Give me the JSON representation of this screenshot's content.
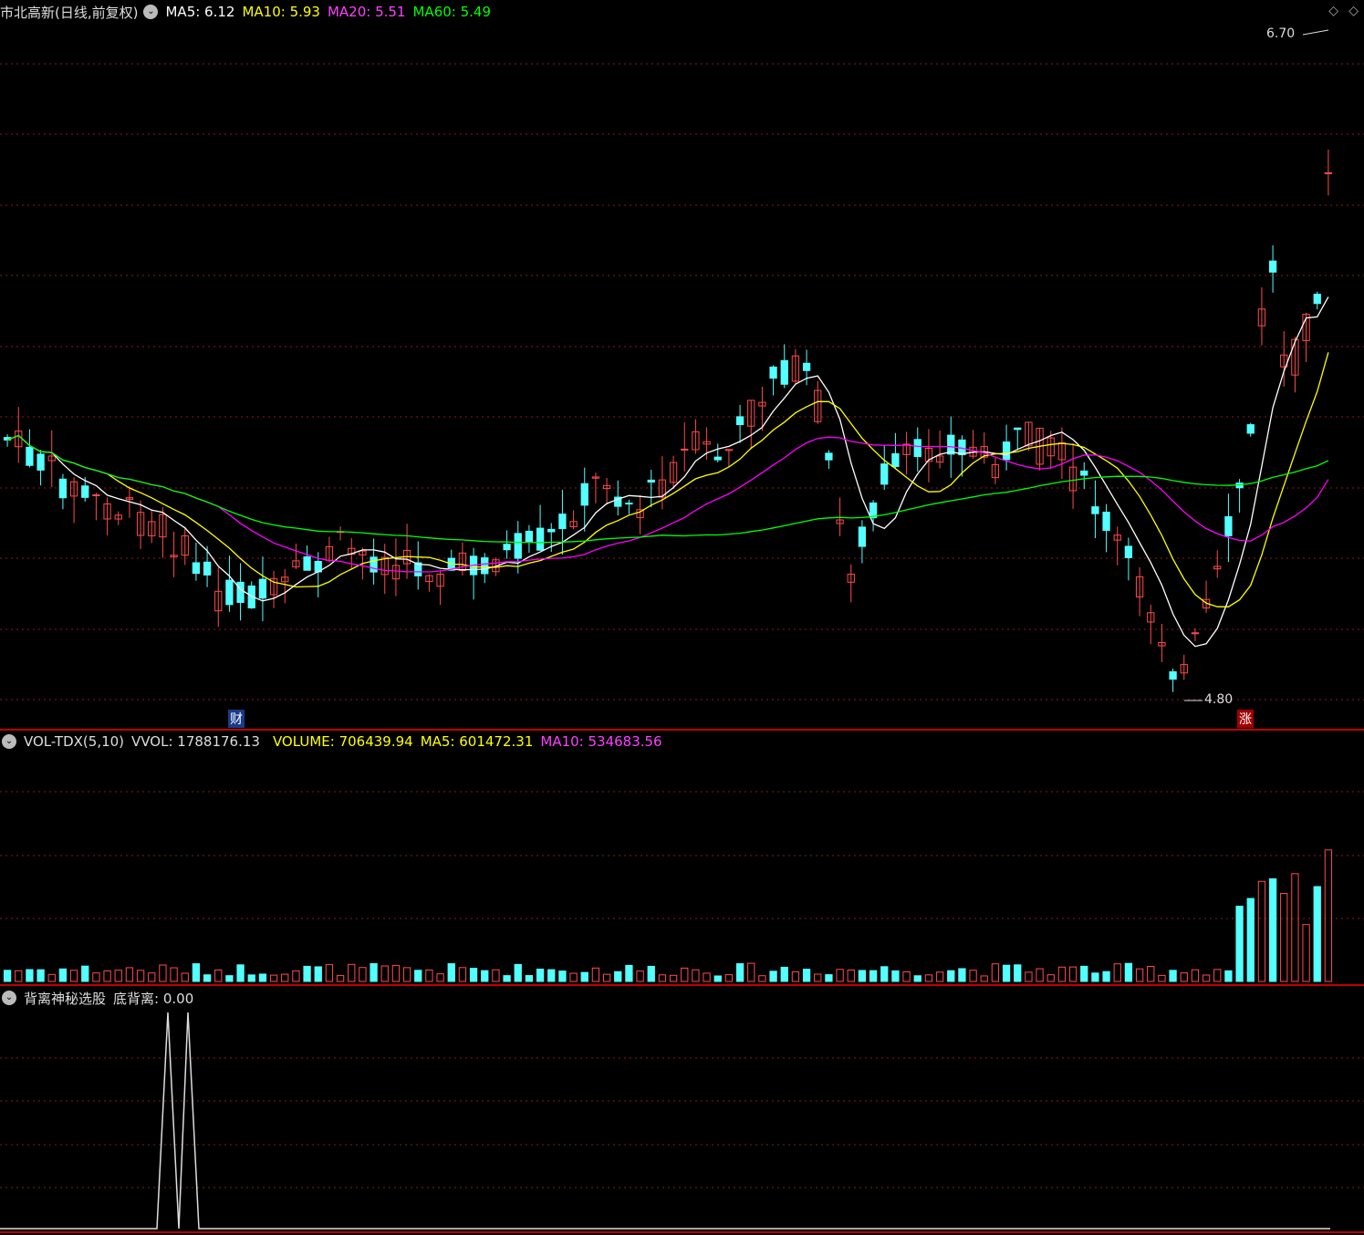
{
  "main": {
    "title": "市北高新(日线,前复权)",
    "ma5": "MA5: 6.12",
    "ma10": "MA10: 5.93",
    "ma20": "MA20: 5.51",
    "ma60": "MA60: 5.49",
    "high_label": "6.70",
    "low_label": "4.80",
    "cai_tag": "财",
    "zhang_tag": "涨",
    "collapse_icon": "chevron-down-icon",
    "diamond_icon": "diamond-icon"
  },
  "vol": {
    "title": "VOL-TDX(5,10)",
    "vvol": "VVOL: 1788176.13",
    "volume": "VOLUME: 706439.94",
    "ma5": "MA5: 601472.31",
    "ma10": "MA10: 534683.56"
  },
  "indicator": {
    "title": "背离神秘选股",
    "value": "底背离: 0.00"
  },
  "colors": {
    "up": "#ff4b4b",
    "down": "#54ffff",
    "ma5": "#ffffff",
    "ma10": "#ffff00",
    "ma20": "#ff00ff",
    "ma60": "#00ff00",
    "grid": "#8b1a1a",
    "divider": "#c00000"
  },
  "chart_data": {
    "type": "candlestick",
    "price_range": [
      4.8,
      6.7
    ],
    "series": [
      "MA5",
      "MA10",
      "MA20",
      "MA60"
    ]
  }
}
